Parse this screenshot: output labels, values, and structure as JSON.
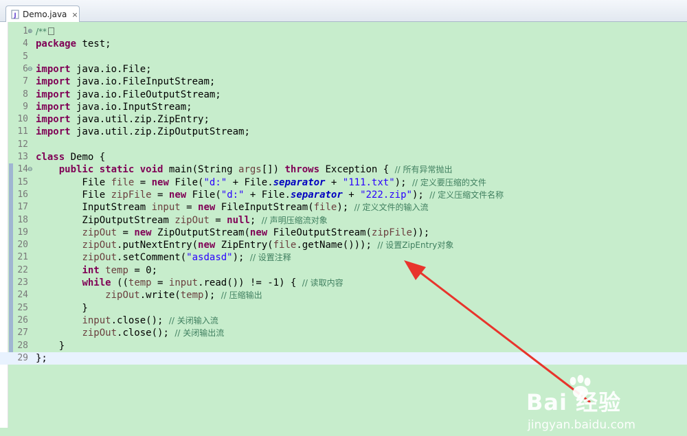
{
  "tab": {
    "title": "Demo.java",
    "close_icon": "×",
    "icon": "java-file-icon"
  },
  "lines": [
    {
      "n": "1",
      "fold": "+",
      "tokens": [
        [
          "c",
          "/**"
        ]
      ],
      "folded": true
    },
    {
      "n": "4",
      "tokens": [
        [
          "k",
          "package"
        ],
        [
          "p",
          " test;"
        ]
      ]
    },
    {
      "n": "5",
      "tokens": []
    },
    {
      "n": "6",
      "fold": "-",
      "tokens": [
        [
          "k",
          "import"
        ],
        [
          "p",
          " java.io.File;"
        ]
      ]
    },
    {
      "n": "7",
      "tokens": [
        [
          "k",
          "import"
        ],
        [
          "p",
          " java.io.FileInputStream;"
        ]
      ]
    },
    {
      "n": "8",
      "tokens": [
        [
          "k",
          "import"
        ],
        [
          "p",
          " java.io.FileOutputStream;"
        ]
      ]
    },
    {
      "n": "9",
      "tokens": [
        [
          "k",
          "import"
        ],
        [
          "p",
          " java.io.InputStream;"
        ]
      ]
    },
    {
      "n": "10",
      "tokens": [
        [
          "k",
          "import"
        ],
        [
          "p",
          " java.util.zip.ZipEntry;"
        ]
      ]
    },
    {
      "n": "11",
      "tokens": [
        [
          "k",
          "import"
        ],
        [
          "p",
          " java.util.zip.ZipOutputStream;"
        ]
      ]
    },
    {
      "n": "12",
      "tokens": []
    },
    {
      "n": "13",
      "tokens": [
        [
          "k",
          "class"
        ],
        [
          "p",
          " Demo {"
        ]
      ]
    },
    {
      "n": "14",
      "fold": "-",
      "tokens": [
        [
          "p",
          "    "
        ],
        [
          "k",
          "public static void"
        ],
        [
          "p",
          " main(String "
        ],
        [
          "v",
          "args"
        ],
        [
          "p",
          "[]) "
        ],
        [
          "k",
          "throws"
        ],
        [
          "p",
          " Exception { "
        ],
        [
          "c",
          "// 所有异常抛出"
        ]
      ]
    },
    {
      "n": "15",
      "tokens": [
        [
          "p",
          "        File "
        ],
        [
          "v",
          "file"
        ],
        [
          "p",
          " = "
        ],
        [
          "k",
          "new"
        ],
        [
          "p",
          " File("
        ],
        [
          "s",
          "\"d:\""
        ],
        [
          "p",
          " + File."
        ],
        [
          "f",
          "separator"
        ],
        [
          "p",
          " + "
        ],
        [
          "s",
          "\"111.txt\""
        ],
        [
          "p",
          "); "
        ],
        [
          "c",
          "// 定义要压缩的文件"
        ]
      ]
    },
    {
      "n": "16",
      "tokens": [
        [
          "p",
          "        File "
        ],
        [
          "v",
          "zipFile"
        ],
        [
          "p",
          " = "
        ],
        [
          "k",
          "new"
        ],
        [
          "p",
          " File("
        ],
        [
          "s",
          "\"d:\""
        ],
        [
          "p",
          " + File."
        ],
        [
          "f",
          "separator"
        ],
        [
          "p",
          " + "
        ],
        [
          "s",
          "\"222.zip\""
        ],
        [
          "p",
          "); "
        ],
        [
          "c",
          "// 定义压缩文件名称"
        ]
      ]
    },
    {
      "n": "17",
      "tokens": [
        [
          "p",
          "        InputStream "
        ],
        [
          "v",
          "input"
        ],
        [
          "p",
          " = "
        ],
        [
          "k",
          "new"
        ],
        [
          "p",
          " FileInputStream("
        ],
        [
          "v",
          "file"
        ],
        [
          "p",
          "); "
        ],
        [
          "c",
          "// 定义文件的输入流"
        ]
      ]
    },
    {
      "n": "18",
      "tokens": [
        [
          "p",
          "        ZipOutputStream "
        ],
        [
          "v",
          "zipOut"
        ],
        [
          "p",
          " = "
        ],
        [
          "k",
          "null"
        ],
        [
          "p",
          "; "
        ],
        [
          "c",
          "// 声明压缩流对象"
        ]
      ]
    },
    {
      "n": "19",
      "tokens": [
        [
          "p",
          "        "
        ],
        [
          "v",
          "zipOut"
        ],
        [
          "p",
          " = "
        ],
        [
          "k",
          "new"
        ],
        [
          "p",
          " ZipOutputStream("
        ],
        [
          "k",
          "new"
        ],
        [
          "p",
          " FileOutputStream("
        ],
        [
          "v",
          "zipFile"
        ],
        [
          "p",
          "));"
        ]
      ]
    },
    {
      "n": "20",
      "tokens": [
        [
          "p",
          "        "
        ],
        [
          "v",
          "zipOut"
        ],
        [
          "p",
          ".putNextEntry("
        ],
        [
          "k",
          "new"
        ],
        [
          "p",
          " ZipEntry("
        ],
        [
          "v",
          "file"
        ],
        [
          "p",
          ".getName())); "
        ],
        [
          "c",
          "// 设置ZipEntry对象"
        ]
      ]
    },
    {
      "n": "21",
      "tokens": [
        [
          "p",
          "        "
        ],
        [
          "v",
          "zipOut"
        ],
        [
          "p",
          ".setComment("
        ],
        [
          "s",
          "\"asdasd\""
        ],
        [
          "p",
          "); "
        ],
        [
          "c",
          "// 设置注释"
        ]
      ]
    },
    {
      "n": "22",
      "tokens": [
        [
          "p",
          "        "
        ],
        [
          "k",
          "int"
        ],
        [
          "p",
          " "
        ],
        [
          "v",
          "temp"
        ],
        [
          "p",
          " = 0;"
        ]
      ]
    },
    {
      "n": "23",
      "tokens": [
        [
          "p",
          "        "
        ],
        [
          "k",
          "while"
        ],
        [
          "p",
          " (("
        ],
        [
          "v",
          "temp"
        ],
        [
          "p",
          " = "
        ],
        [
          "v",
          "input"
        ],
        [
          "p",
          ".read()) != -1) { "
        ],
        [
          "c",
          "// 读取内容"
        ]
      ]
    },
    {
      "n": "24",
      "tokens": [
        [
          "p",
          "            "
        ],
        [
          "v",
          "zipOut"
        ],
        [
          "p",
          ".write("
        ],
        [
          "v",
          "temp"
        ],
        [
          "p",
          "); "
        ],
        [
          "c",
          "// 压缩输出"
        ]
      ]
    },
    {
      "n": "25",
      "tokens": [
        [
          "p",
          "        }"
        ]
      ]
    },
    {
      "n": "26",
      "tokens": [
        [
          "p",
          "        "
        ],
        [
          "v",
          "input"
        ],
        [
          "p",
          ".close(); "
        ],
        [
          "c",
          "// 关闭输入流"
        ]
      ]
    },
    {
      "n": "27",
      "tokens": [
        [
          "p",
          "        "
        ],
        [
          "v",
          "zipOut"
        ],
        [
          "p",
          ".close(); "
        ],
        [
          "c",
          "// 关闭输出流"
        ]
      ]
    },
    {
      "n": "28",
      "tokens": [
        [
          "p",
          "    }"
        ]
      ]
    },
    {
      "n": "29",
      "tokens": [
        [
          "p",
          "};"
        ]
      ],
      "current": true
    }
  ],
  "watermark": {
    "logo": "Bai  经验",
    "site": "jingyan.baidu.com"
  },
  "colors": {
    "editor_bg": "#c7edcc",
    "keyword": "#7f0055",
    "string": "#2a00ff",
    "comment": "#3f7f5f",
    "arrow": "#e8342c"
  }
}
